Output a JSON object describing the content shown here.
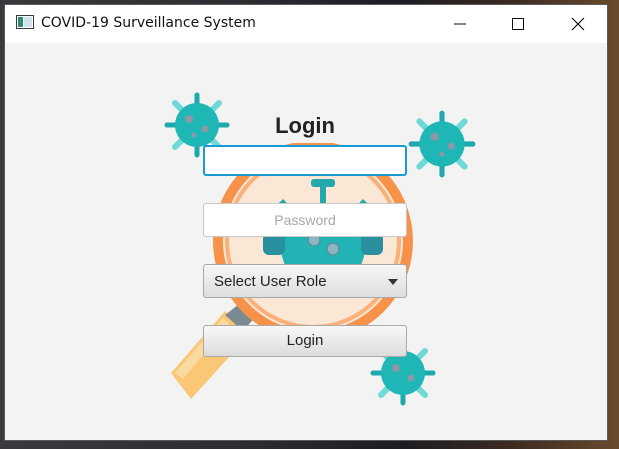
{
  "window": {
    "title": "COVID-19 Surveillance System",
    "icon": "app-window-icon",
    "controls": [
      "minimize-icon",
      "maximize-icon",
      "close-icon"
    ]
  },
  "login": {
    "heading": "Login",
    "username_value": "",
    "password_placeholder": "Password",
    "role_select": {
      "selected": "Select User Role"
    },
    "submit_label": "Login"
  },
  "colors": {
    "focus_border": "#1a9bd7",
    "virus_teal": "#1fb6b6",
    "virus_light": "#6fd9d6",
    "magnifier_orange": "#f7924a",
    "handle_yellow": "#f9c775"
  }
}
